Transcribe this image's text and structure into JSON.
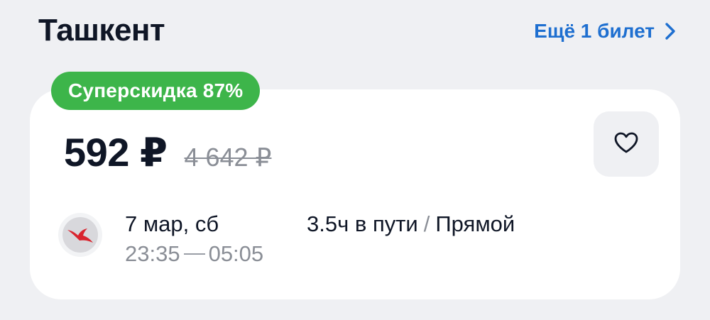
{
  "header": {
    "city": "Ташкент",
    "more_tickets": "Ещё 1 билет"
  },
  "card": {
    "badge": "Суперскидка 87%",
    "price_current": "592 ₽",
    "price_old": "4 642 ₽",
    "flight": {
      "date": "7 мар, сб",
      "departure": "23:35",
      "arrival": "05:05",
      "duration": "3.5ч в пути",
      "separator": "/",
      "type": "Прямой"
    }
  },
  "icons": {
    "more_arrow": "chevron-right-icon",
    "favorite": "heart-icon",
    "airline": "airline-bird-logo"
  },
  "colors": {
    "accent": "#1e6fd0",
    "badge": "#3db54a",
    "logo_bird": "#d9252f"
  }
}
